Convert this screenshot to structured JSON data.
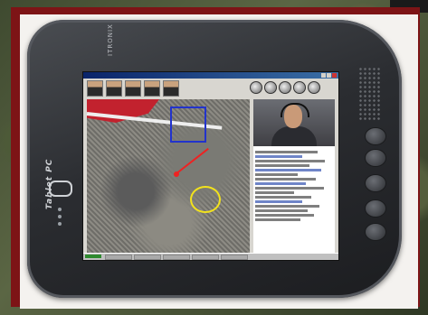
{
  "device": {
    "brand_label": "ITRONIX",
    "product_label": "Tablet PC"
  },
  "colors": {
    "frame_maroon": "#7d1416",
    "tablet_body": "#2b2d31",
    "map_route": "#c2222e",
    "map_box": "#2233cc",
    "map_ring": "#f2e21c"
  },
  "screen": {
    "window": "map-and-video-conference-application",
    "panels": [
      "satellite-map",
      "video-feed",
      "chat-log"
    ]
  }
}
